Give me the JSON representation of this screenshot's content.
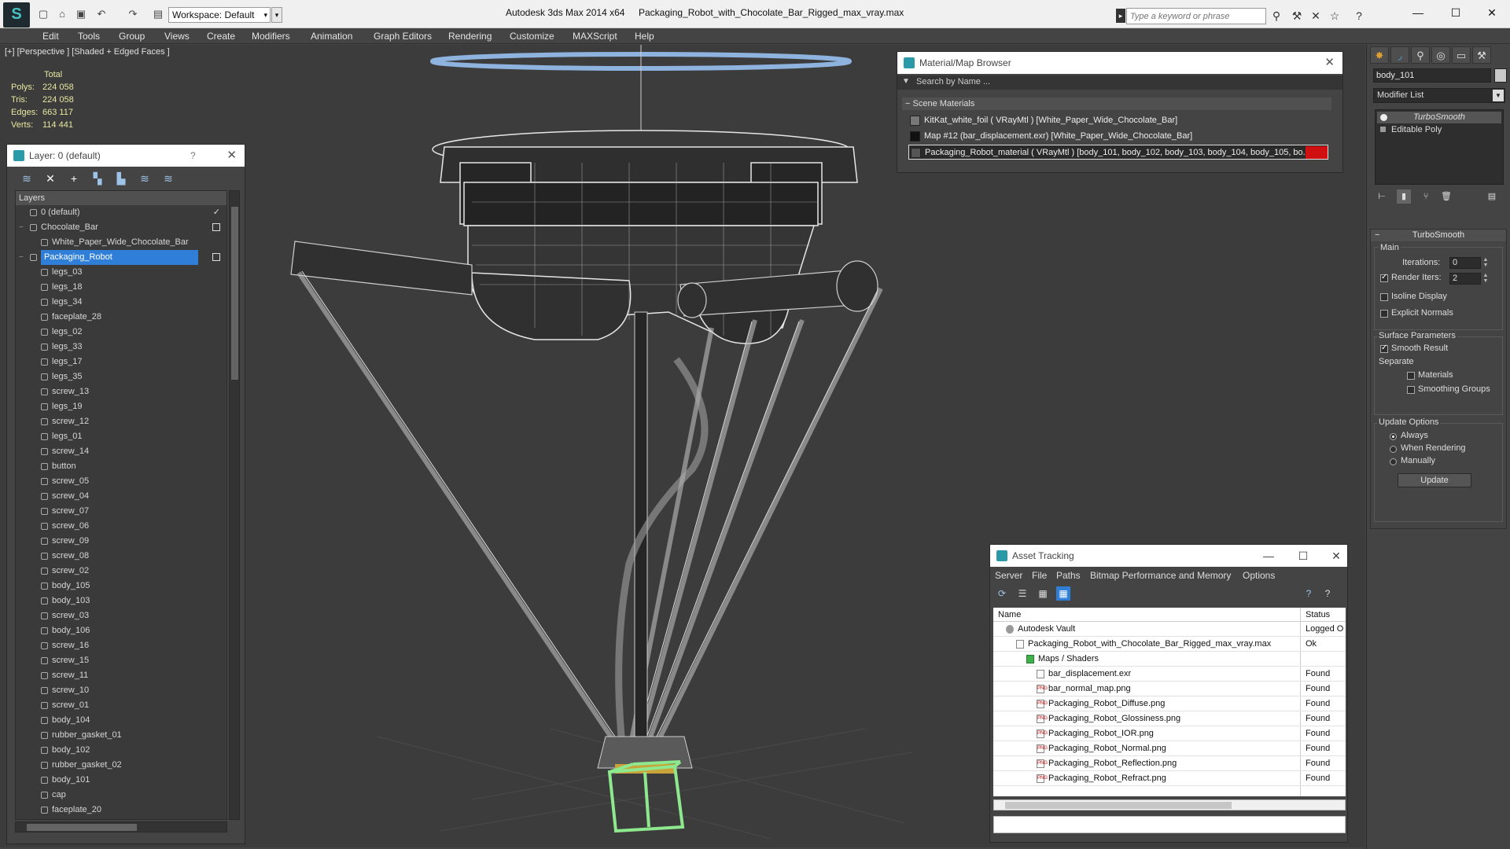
{
  "window": {
    "app_name": "Autodesk 3ds Max  2014 x64",
    "file_name": "Packaging_Robot_with_Chocolate_Bar_Rigged_max_vray.max",
    "workspace": "Workspace: Default",
    "search_placeholder": "Type a keyword or phrase"
  },
  "menu": [
    "Edit",
    "Tools",
    "Group",
    "Views",
    "Create",
    "Modifiers",
    "Animation",
    "Graph Editors",
    "Rendering",
    "Customize",
    "MAXScript",
    "Help"
  ],
  "viewport": {
    "label": "[+] [Perspective ] [Shaded + Edged Faces ]",
    "stats": {
      "header": "Total",
      "rows": [
        {
          "label": "Polys:",
          "value": "224 058"
        },
        {
          "label": "Tris:",
          "value": "224 058"
        },
        {
          "label": "Edges:",
          "value": "663 117"
        },
        {
          "label": "Verts:",
          "value": "114 441"
        }
      ]
    }
  },
  "layer_explorer": {
    "title": "Layer: 0 (default)",
    "help": "?",
    "column_header": "Layers",
    "rows": [
      {
        "label": "0 (default)",
        "level": 0,
        "active": true
      },
      {
        "label": "Chocolate_Bar",
        "level": 0,
        "toggle": true
      },
      {
        "label": "White_Paper_Wide_Chocolate_Bar",
        "level": 1
      },
      {
        "label": "Packaging_Robot",
        "level": 0,
        "selected": true,
        "toggle": true
      },
      {
        "label": "legs_03",
        "level": 1
      },
      {
        "label": "legs_18",
        "level": 1
      },
      {
        "label": "legs_34",
        "level": 1
      },
      {
        "label": "faceplate_28",
        "level": 1
      },
      {
        "label": "legs_02",
        "level": 1
      },
      {
        "label": "legs_33",
        "level": 1
      },
      {
        "label": "legs_17",
        "level": 1
      },
      {
        "label": "legs_35",
        "level": 1
      },
      {
        "label": "screw_13",
        "level": 1
      },
      {
        "label": "legs_19",
        "level": 1
      },
      {
        "label": "screw_12",
        "level": 1
      },
      {
        "label": "legs_01",
        "level": 1
      },
      {
        "label": "screw_14",
        "level": 1
      },
      {
        "label": "button",
        "level": 1
      },
      {
        "label": "screw_05",
        "level": 1
      },
      {
        "label": "screw_04",
        "level": 1
      },
      {
        "label": "screw_07",
        "level": 1
      },
      {
        "label": "screw_06",
        "level": 1
      },
      {
        "label": "screw_09",
        "level": 1
      },
      {
        "label": "screw_08",
        "level": 1
      },
      {
        "label": "screw_02",
        "level": 1
      },
      {
        "label": "body_105",
        "level": 1
      },
      {
        "label": "body_103",
        "level": 1
      },
      {
        "label": "screw_03",
        "level": 1
      },
      {
        "label": "body_106",
        "level": 1
      },
      {
        "label": "screw_16",
        "level": 1
      },
      {
        "label": "screw_15",
        "level": 1
      },
      {
        "label": "screw_11",
        "level": 1
      },
      {
        "label": "screw_10",
        "level": 1
      },
      {
        "label": "screw_01",
        "level": 1
      },
      {
        "label": "body_104",
        "level": 1
      },
      {
        "label": "rubber_gasket_01",
        "level": 1
      },
      {
        "label": "body_102",
        "level": 1
      },
      {
        "label": "rubber_gasket_02",
        "level": 1
      },
      {
        "label": "body_101",
        "level": 1
      },
      {
        "label": "cap",
        "level": 1
      },
      {
        "label": "faceplate_20",
        "level": 1
      }
    ]
  },
  "material_browser": {
    "title": "Material/Map Browser",
    "search_placeholder": "Search by Name ...",
    "group": "Scene Materials",
    "items": [
      {
        "label": "KitKat_white_foil  ( VRayMtl )  [White_Paper_Wide_Chocolate_Bar]"
      },
      {
        "label": "Map #12 (bar_displacement.exr)  [White_Paper_Wide_Chocolate_Bar]"
      },
      {
        "label": "Packaging_Robot_material  ( VRayMtl )  [body_101, body_102, body_103, body_104, body_105, bo...",
        "selected": true
      }
    ]
  },
  "command_panel": {
    "object_name": "body_101",
    "modifier_list": "Modifier List",
    "stack": [
      "TurboSmooth",
      "Editable Poly"
    ],
    "turbosmooth": {
      "title": "TurboSmooth",
      "main_label": "Main",
      "iterations_label": "Iterations:",
      "iterations_value": "0",
      "render_iters_label": "Render Iters:",
      "render_iters_value": "2",
      "isoline_label": "Isoline Display",
      "explicit_label": "Explicit Normals",
      "surface_label": "Surface Parameters",
      "smooth_label": "Smooth Result",
      "separate_label": "Separate",
      "materials_label": "Materials",
      "smoothing_groups_label": "Smoothing Groups",
      "update_options_label": "Update Options",
      "always_label": "Always",
      "when_rendering_label": "When Rendering",
      "manually_label": "Manually",
      "update_button": "Update"
    }
  },
  "asset_tracking": {
    "title": "Asset Tracking",
    "menu": [
      "Server",
      "File",
      "Paths",
      "Bitmap Performance and Memory",
      "Options"
    ],
    "col_name": "Name",
    "col_status": "Status",
    "rows": [
      {
        "name": "Autodesk Vault",
        "status": "Logged O",
        "level": 0
      },
      {
        "name": "Packaging_Robot_with_Chocolate_Bar_Rigged_max_vray.max",
        "status": "Ok",
        "level": 1
      },
      {
        "name": "Maps / Shaders",
        "status": "",
        "level": 2
      },
      {
        "name": "bar_displacement.exr",
        "status": "Found",
        "level": 3
      },
      {
        "name": "bar_normal_map.png",
        "status": "Found",
        "level": 3
      },
      {
        "name": "Packaging_Robot_Diffuse.png",
        "status": "Found",
        "level": 3
      },
      {
        "name": "Packaging_Robot_Glossiness.png",
        "status": "Found",
        "level": 3
      },
      {
        "name": "Packaging_Robot_IOR.png",
        "status": "Found",
        "level": 3
      },
      {
        "name": "Packaging_Robot_Normal.png",
        "status": "Found",
        "level": 3
      },
      {
        "name": "Packaging_Robot_Reflection.png",
        "status": "Found",
        "level": 3
      },
      {
        "name": "Packaging_Robot_Refract.png",
        "status": "Found",
        "level": 3
      }
    ]
  },
  "colors": {
    "selection": "#2f7fd9",
    "viewport_bg": "#3c3c3c",
    "stats_text": "#e8e8a0",
    "bbox_green": "#8ee88e"
  }
}
